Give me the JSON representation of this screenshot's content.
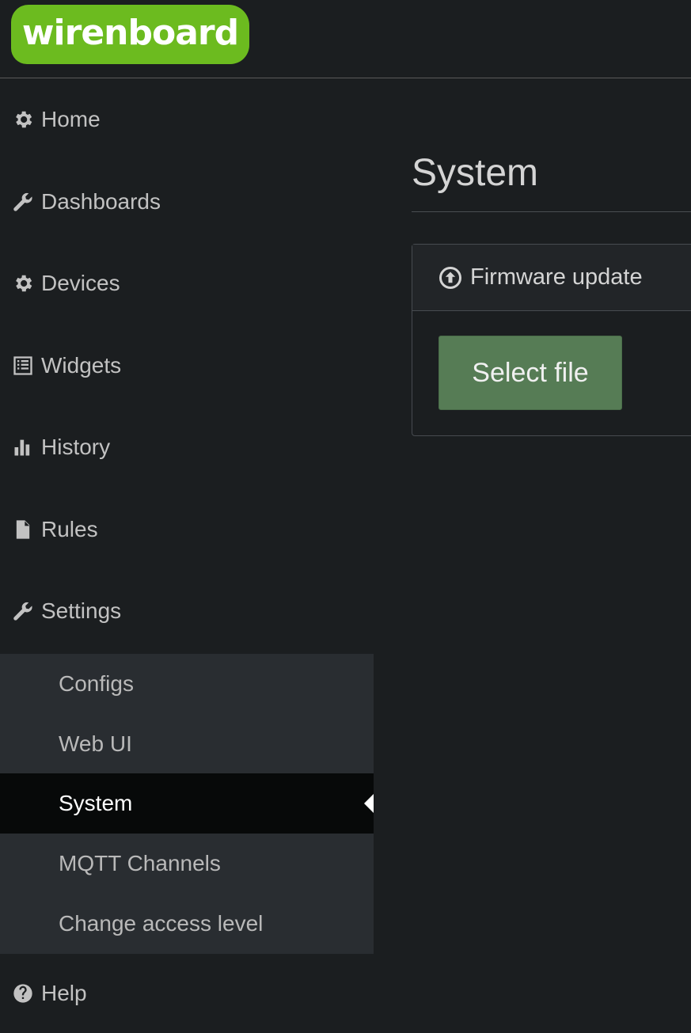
{
  "brand": {
    "logo_text": "wirenboard",
    "logo_color": "#6cbb1f"
  },
  "sidebar": {
    "items": [
      {
        "label": "Home",
        "icon": "gear-icon"
      },
      {
        "label": "Dashboards",
        "icon": "wrench-icon"
      },
      {
        "label": "Devices",
        "icon": "gear-icon"
      },
      {
        "label": "Widgets",
        "icon": "list-icon"
      },
      {
        "label": "History",
        "icon": "bar-chart-icon"
      },
      {
        "label": "Rules",
        "icon": "file-icon"
      },
      {
        "label": "Settings",
        "icon": "wrench-icon"
      }
    ],
    "submenu": [
      {
        "label": "Configs"
      },
      {
        "label": "Web UI"
      },
      {
        "label": "System",
        "active": true
      },
      {
        "label": "MQTT Channels"
      },
      {
        "label": "Change access level"
      }
    ],
    "help": {
      "label": "Help",
      "icon": "question-circle-icon"
    }
  },
  "main": {
    "title": "System",
    "panel": {
      "heading": "Firmware update",
      "heading_icon": "upload-circle-icon",
      "button_label": "Select file",
      "button_color": "#567c55"
    }
  }
}
